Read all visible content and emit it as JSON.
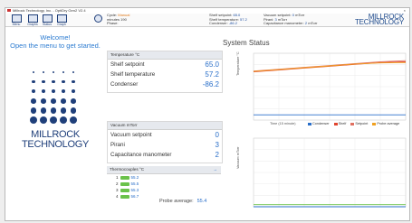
{
  "window": {
    "title": "Millrock Technology, Inc. - OptiDry Gen2 V2.4",
    "close_symbol": "×"
  },
  "toolbar": {
    "buttons": [
      {
        "label": "Menu",
        "icon": "menu-icon"
      },
      {
        "label": "Graphs",
        "icon": "graph-icon"
      },
      {
        "label": "Status",
        "icon": "status-icon"
      },
      {
        "label": "Graph",
        "icon": "graph-icon"
      }
    ],
    "info_icon": "info-icon",
    "cycle_label": "Cycle:",
    "cycle_value": "Manual",
    "phase_label": "Phase:",
    "minutes_label": "minutes",
    "minutes_value": "190",
    "minutes2_label": "minutes",
    "minutes2_value": "130",
    "shelf_sp_label": "Shelf setpoint:",
    "shelf_sp_value": "65.0",
    "shelf_label": "Shelf temperature:",
    "shelf_value": "57.2",
    "cond_label": "Condenser:",
    "cond_value": "-86.2",
    "vac_sp_label": "Vacuum setpoint:",
    "vac_sp_value": "0",
    "vac_sp_unit": "mTorr",
    "pirani_label": "Pirani:",
    "pirani_value": "3",
    "pirani_unit": "mTorr",
    "cap_label": "Capacitance manometer:",
    "cap_value": "2",
    "cap_unit": "mTorr"
  },
  "logo": {
    "line1": "MILLROCK",
    "line2": "TECHNOLOGY"
  },
  "welcome": {
    "title": "Welcome!",
    "subtitle": "Open the menu to get started."
  },
  "brand": {
    "line1": "MILLROCK",
    "line2": "TECHNOLOGY"
  },
  "system_status_title": "System Status",
  "temperature_panel": {
    "header": "Temperature °C",
    "rows": [
      {
        "label": "Shelf setpoint",
        "value": "65.0"
      },
      {
        "label": "Shelf temperature",
        "value": "57.2"
      },
      {
        "label": "Condenser",
        "value": "-86.2"
      }
    ]
  },
  "vacuum_panel": {
    "header": "Vacuum  mTorr",
    "rows": [
      {
        "label": "Vacuum setpoint",
        "value": "0"
      },
      {
        "label": "Pirani",
        "value": "3"
      },
      {
        "label": "Capacitance manometer",
        "value": "2"
      }
    ]
  },
  "thermocouple_panel": {
    "header": "Thermocouples °C",
    "header_symbol": "→",
    "rows": [
      {
        "label": "1",
        "value": "55.2"
      },
      {
        "label": "2",
        "value": "55.5"
      },
      {
        "label": "3",
        "value": "55.3"
      },
      {
        "label": "4",
        "value": "56.7"
      }
    ]
  },
  "probe": {
    "label": "Probe average:",
    "value": "55.4"
  },
  "temp_chart": {
    "ylabel": "Temperature °C",
    "xlabel": "Time (15 minute)",
    "legend": [
      "Condenser",
      "Shelf",
      "Setpoint",
      "Probe average"
    ],
    "colors": {
      "condenser": "#2a6fc9",
      "shelf": "#e0452f",
      "setpoint": "#e0452f",
      "probe": "#f0a020"
    }
  },
  "vac_chart": {
    "ylabel": "Vacuum mTorr",
    "colors": {
      "pirani": "#6ac24a",
      "setpoint": "#2a6fc9"
    }
  },
  "chart_data": [
    {
      "type": "line",
      "ylabel": "Temperature °C",
      "xlabel": "Time (15 minute)",
      "series": [
        {
          "name": "Shelf",
          "values": [
            30,
            35,
            40,
            45,
            50,
            55,
            57
          ]
        },
        {
          "name": "Setpoint",
          "values": [
            32,
            37,
            42,
            47,
            52,
            57,
            60
          ]
        },
        {
          "name": "Probe average",
          "values": [
            31,
            36,
            41,
            46,
            51,
            54,
            55
          ]
        },
        {
          "name": "Condenser",
          "values": [
            -86,
            -86,
            -86,
            -86,
            -86,
            -86,
            -86
          ]
        }
      ],
      "x": [
        0,
        1,
        2,
        3,
        4,
        5,
        6
      ]
    },
    {
      "type": "line",
      "ylabel": "Vacuum mTorr",
      "series": [
        {
          "name": "Pirani",
          "values": [
            3,
            3,
            3,
            3,
            3,
            3,
            3
          ]
        },
        {
          "name": "Setpoint",
          "values": [
            0,
            0,
            0,
            0,
            0,
            0,
            0
          ]
        }
      ],
      "x": [
        0,
        1,
        2,
        3,
        4,
        5,
        6
      ]
    }
  ]
}
